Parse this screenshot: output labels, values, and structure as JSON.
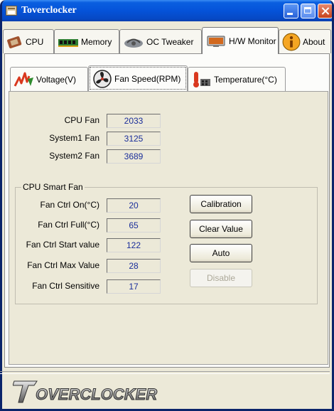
{
  "window": {
    "title": "Toverclocker"
  },
  "main_tabs": [
    {
      "label": "CPU",
      "icon": "cpu-chip-icon"
    },
    {
      "label": "Memory",
      "icon": "memory-module-icon"
    },
    {
      "label": "OC Tweaker",
      "icon": "car-speedometer-icon"
    },
    {
      "label": "H/W Monitor",
      "icon": "monitor-icon",
      "active": true
    },
    {
      "label": "About",
      "icon": "info-icon"
    }
  ],
  "sub_tabs": [
    {
      "label": "Voltage(V)",
      "icon": "voltage-icon"
    },
    {
      "label": "Fan Speed(RPM)",
      "icon": "fan-icon",
      "active": true
    },
    {
      "label": "Temperature(°C)",
      "icon": "thermometer-icon"
    }
  ],
  "fans": [
    {
      "label": "CPU Fan",
      "value": "2033"
    },
    {
      "label": "System1 Fan",
      "value": "3125"
    },
    {
      "label": "System2 Fan",
      "value": "3689"
    }
  ],
  "smart_fan": {
    "title": "CPU Smart Fan",
    "rows": [
      {
        "label": "Fan Ctrl On(°C)",
        "value": "20"
      },
      {
        "label": "Fan Ctrl Full(°C)",
        "value": "65"
      },
      {
        "label": "Fan Ctrl Start value",
        "value": "122"
      },
      {
        "label": "Fan Ctrl Max Value",
        "value": "28"
      },
      {
        "label": "Fan Ctrl Sensitive",
        "value": "17"
      }
    ],
    "buttons": [
      {
        "label": "Calibration",
        "enabled": true
      },
      {
        "label": "Clear Value",
        "enabled": true
      },
      {
        "label": "Auto",
        "enabled": true
      },
      {
        "label": "Disable",
        "enabled": false
      }
    ]
  },
  "footer": {
    "logo_text": "OVERCLOCKER"
  },
  "colors": {
    "title_bar": "#0553d9",
    "field_text": "#1a2e9a",
    "window_bg": "#ece9d8"
  }
}
